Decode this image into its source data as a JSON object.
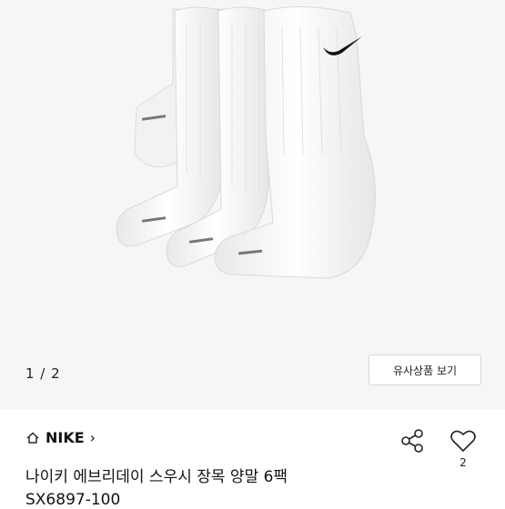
{
  "product_image": {
    "alt": "white crew socks 6 pack",
    "icon": "product-photo"
  },
  "pager": {
    "indicator": "1 / 2",
    "similar_button": "유사상품 보기"
  },
  "product": {
    "brand": "NIKE",
    "brand_icon": "home-icon",
    "title": "나이키 에브리데이 스우시 장목 양말 6팩",
    "sku": "SX6897-100",
    "like_count": "2"
  },
  "colors": {
    "background": "#f6f6f6",
    "text": "#111111",
    "border": "#d8d8d8"
  }
}
